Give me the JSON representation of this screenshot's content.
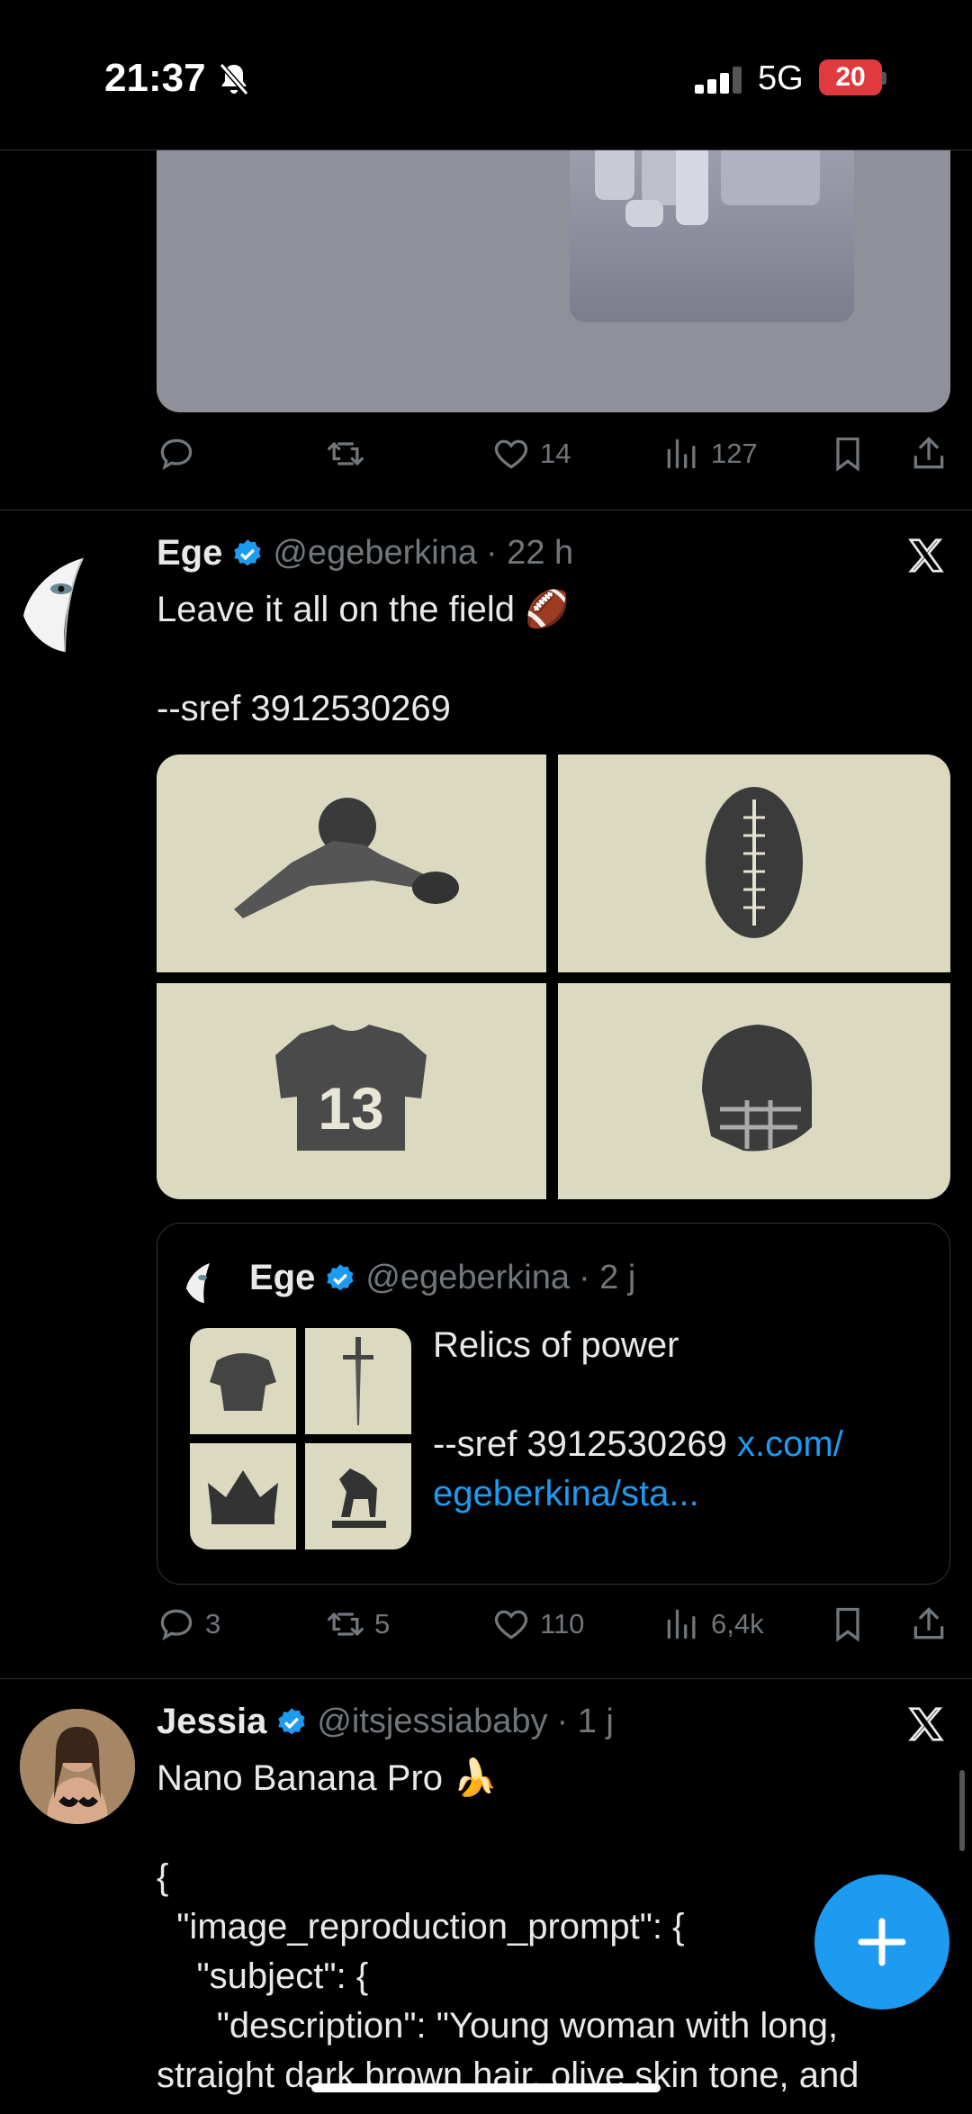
{
  "status_bar": {
    "time": "21:37",
    "network": "5G",
    "battery": "20"
  },
  "tweet1": {
    "actions": {
      "reply": "",
      "retweet": "",
      "like": "14",
      "views": "127"
    }
  },
  "tweet2": {
    "name": "Ege",
    "handle": "@egeberkina",
    "time": "· 22 h",
    "text": "Leave it all on the field 🏈\n\n--sref 3912530269",
    "quote": {
      "name": "Ege",
      "handle": "@egeberkina",
      "time": "· 2 j",
      "text": "Relics of power\n\n--sref 3912530269 ",
      "link": "x.com/\negeberkina/sta..."
    },
    "actions": {
      "reply": "3",
      "retweet": "5",
      "like": "110",
      "views": "6,4k"
    }
  },
  "tweet3": {
    "name": "Jessia",
    "handle": "@itsjessiababy",
    "time": "· 1 j",
    "text": "Nano Banana Pro 🍌\n\n{\n  \"image_reproduction_prompt\": {\n    \"subject\": {\n      \"description\": \"Young woman with long,\nstraight dark brown hair, olive skin tone, and"
  },
  "icons": {
    "accent": "#1d9bf0",
    "grid_images": [
      "football-player-icon",
      "football-icon",
      "jersey-13-icon",
      "helmet-icon"
    ],
    "quote_images": [
      "armor-icon",
      "sword-icon",
      "crown-icon",
      "horse-statue-icon"
    ]
  },
  "jersey_number": "13"
}
